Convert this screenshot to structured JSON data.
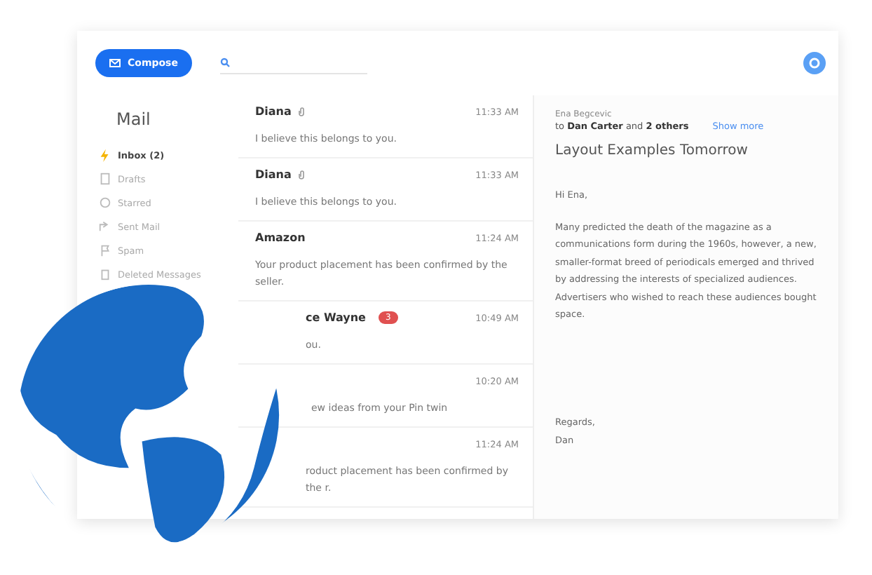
{
  "compose_button": {
    "label": "Compose"
  },
  "sidebar": {
    "title": "Mail",
    "items": [
      {
        "label": "Inbox (2)",
        "selected": true
      },
      {
        "label": "Drafts",
        "selected": false
      },
      {
        "label": "Starred",
        "selected": false
      },
      {
        "label": "Sent Mail",
        "selected": false
      },
      {
        "label": "Spam",
        "selected": false
      },
      {
        "label": "Deleted Messages",
        "selected": false
      }
    ]
  },
  "messages": [
    {
      "sender": "Diana",
      "attachment": true,
      "time": "11:33 AM",
      "preview": "I believe this belongs to you."
    },
    {
      "sender": "Diana",
      "attachment": true,
      "time": "11:33 AM",
      "preview": "I believe this belongs to you."
    },
    {
      "sender": "Amazon",
      "attachment": false,
      "time": "11:24 AM",
      "preview": "Your product placement has been confirmed by the seller."
    },
    {
      "sender": "ce Wayne",
      "attachment": false,
      "badge": "3",
      "time": "10:49 AM",
      "preview": "ou."
    },
    {
      "attachment": false,
      "time": "10:20 AM",
      "preview": "ew ideas from your Pin twin"
    },
    {
      "attachment": false,
      "time": "11:24 AM",
      "preview": "roduct placement has been confirmed by the r."
    }
  ],
  "reader": {
    "from": "Ena Begcevic",
    "to_prefix": "to",
    "to_name": "Dan Carter",
    "to_mid": "and",
    "to_others": "2 others",
    "show_more": "Show more",
    "subject": "Layout Examples Tomorrow",
    "greeting": "Hi Ena,",
    "body": "Many predicted the death of the magazine as a communications form during the 1960s, however, a new, smaller-format breed of periodicals emerged and thrived by addressing the interests of specialized audiences. Advertisers who wished to reach these audiences bought space.",
    "signoff": "Regards,",
    "signature": "Dan"
  }
}
